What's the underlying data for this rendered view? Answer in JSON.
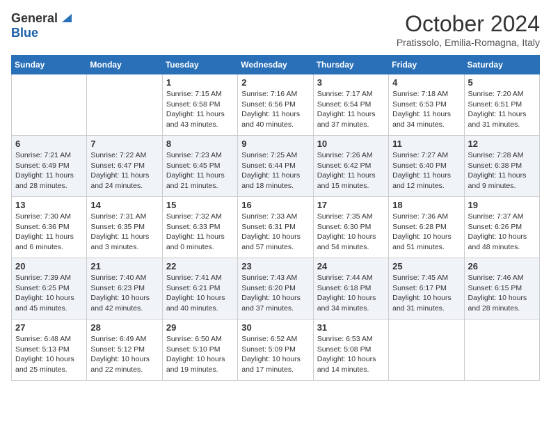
{
  "logo": {
    "general": "General",
    "blue": "Blue"
  },
  "header": {
    "month": "October 2024",
    "location": "Pratissolo, Emilia-Romagna, Italy"
  },
  "weekdays": [
    "Sunday",
    "Monday",
    "Tuesday",
    "Wednesday",
    "Thursday",
    "Friday",
    "Saturday"
  ],
  "weeks": [
    [
      {
        "day": "",
        "info": ""
      },
      {
        "day": "",
        "info": ""
      },
      {
        "day": "1",
        "info": "Sunrise: 7:15 AM\nSunset: 6:58 PM\nDaylight: 11 hours and 43 minutes."
      },
      {
        "day": "2",
        "info": "Sunrise: 7:16 AM\nSunset: 6:56 PM\nDaylight: 11 hours and 40 minutes."
      },
      {
        "day": "3",
        "info": "Sunrise: 7:17 AM\nSunset: 6:54 PM\nDaylight: 11 hours and 37 minutes."
      },
      {
        "day": "4",
        "info": "Sunrise: 7:18 AM\nSunset: 6:53 PM\nDaylight: 11 hours and 34 minutes."
      },
      {
        "day": "5",
        "info": "Sunrise: 7:20 AM\nSunset: 6:51 PM\nDaylight: 11 hours and 31 minutes."
      }
    ],
    [
      {
        "day": "6",
        "info": "Sunrise: 7:21 AM\nSunset: 6:49 PM\nDaylight: 11 hours and 28 minutes."
      },
      {
        "day": "7",
        "info": "Sunrise: 7:22 AM\nSunset: 6:47 PM\nDaylight: 11 hours and 24 minutes."
      },
      {
        "day": "8",
        "info": "Sunrise: 7:23 AM\nSunset: 6:45 PM\nDaylight: 11 hours and 21 minutes."
      },
      {
        "day": "9",
        "info": "Sunrise: 7:25 AM\nSunset: 6:44 PM\nDaylight: 11 hours and 18 minutes."
      },
      {
        "day": "10",
        "info": "Sunrise: 7:26 AM\nSunset: 6:42 PM\nDaylight: 11 hours and 15 minutes."
      },
      {
        "day": "11",
        "info": "Sunrise: 7:27 AM\nSunset: 6:40 PM\nDaylight: 11 hours and 12 minutes."
      },
      {
        "day": "12",
        "info": "Sunrise: 7:28 AM\nSunset: 6:38 PM\nDaylight: 11 hours and 9 minutes."
      }
    ],
    [
      {
        "day": "13",
        "info": "Sunrise: 7:30 AM\nSunset: 6:36 PM\nDaylight: 11 hours and 6 minutes."
      },
      {
        "day": "14",
        "info": "Sunrise: 7:31 AM\nSunset: 6:35 PM\nDaylight: 11 hours and 3 minutes."
      },
      {
        "day": "15",
        "info": "Sunrise: 7:32 AM\nSunset: 6:33 PM\nDaylight: 11 hours and 0 minutes."
      },
      {
        "day": "16",
        "info": "Sunrise: 7:33 AM\nSunset: 6:31 PM\nDaylight: 10 hours and 57 minutes."
      },
      {
        "day": "17",
        "info": "Sunrise: 7:35 AM\nSunset: 6:30 PM\nDaylight: 10 hours and 54 minutes."
      },
      {
        "day": "18",
        "info": "Sunrise: 7:36 AM\nSunset: 6:28 PM\nDaylight: 10 hours and 51 minutes."
      },
      {
        "day": "19",
        "info": "Sunrise: 7:37 AM\nSunset: 6:26 PM\nDaylight: 10 hours and 48 minutes."
      }
    ],
    [
      {
        "day": "20",
        "info": "Sunrise: 7:39 AM\nSunset: 6:25 PM\nDaylight: 10 hours and 45 minutes."
      },
      {
        "day": "21",
        "info": "Sunrise: 7:40 AM\nSunset: 6:23 PM\nDaylight: 10 hours and 42 minutes."
      },
      {
        "day": "22",
        "info": "Sunrise: 7:41 AM\nSunset: 6:21 PM\nDaylight: 10 hours and 40 minutes."
      },
      {
        "day": "23",
        "info": "Sunrise: 7:43 AM\nSunset: 6:20 PM\nDaylight: 10 hours and 37 minutes."
      },
      {
        "day": "24",
        "info": "Sunrise: 7:44 AM\nSunset: 6:18 PM\nDaylight: 10 hours and 34 minutes."
      },
      {
        "day": "25",
        "info": "Sunrise: 7:45 AM\nSunset: 6:17 PM\nDaylight: 10 hours and 31 minutes."
      },
      {
        "day": "26",
        "info": "Sunrise: 7:46 AM\nSunset: 6:15 PM\nDaylight: 10 hours and 28 minutes."
      }
    ],
    [
      {
        "day": "27",
        "info": "Sunrise: 6:48 AM\nSunset: 5:13 PM\nDaylight: 10 hours and 25 minutes."
      },
      {
        "day": "28",
        "info": "Sunrise: 6:49 AM\nSunset: 5:12 PM\nDaylight: 10 hours and 22 minutes."
      },
      {
        "day": "29",
        "info": "Sunrise: 6:50 AM\nSunset: 5:10 PM\nDaylight: 10 hours and 19 minutes."
      },
      {
        "day": "30",
        "info": "Sunrise: 6:52 AM\nSunset: 5:09 PM\nDaylight: 10 hours and 17 minutes."
      },
      {
        "day": "31",
        "info": "Sunrise: 6:53 AM\nSunset: 5:08 PM\nDaylight: 10 hours and 14 minutes."
      },
      {
        "day": "",
        "info": ""
      },
      {
        "day": "",
        "info": ""
      }
    ]
  ]
}
